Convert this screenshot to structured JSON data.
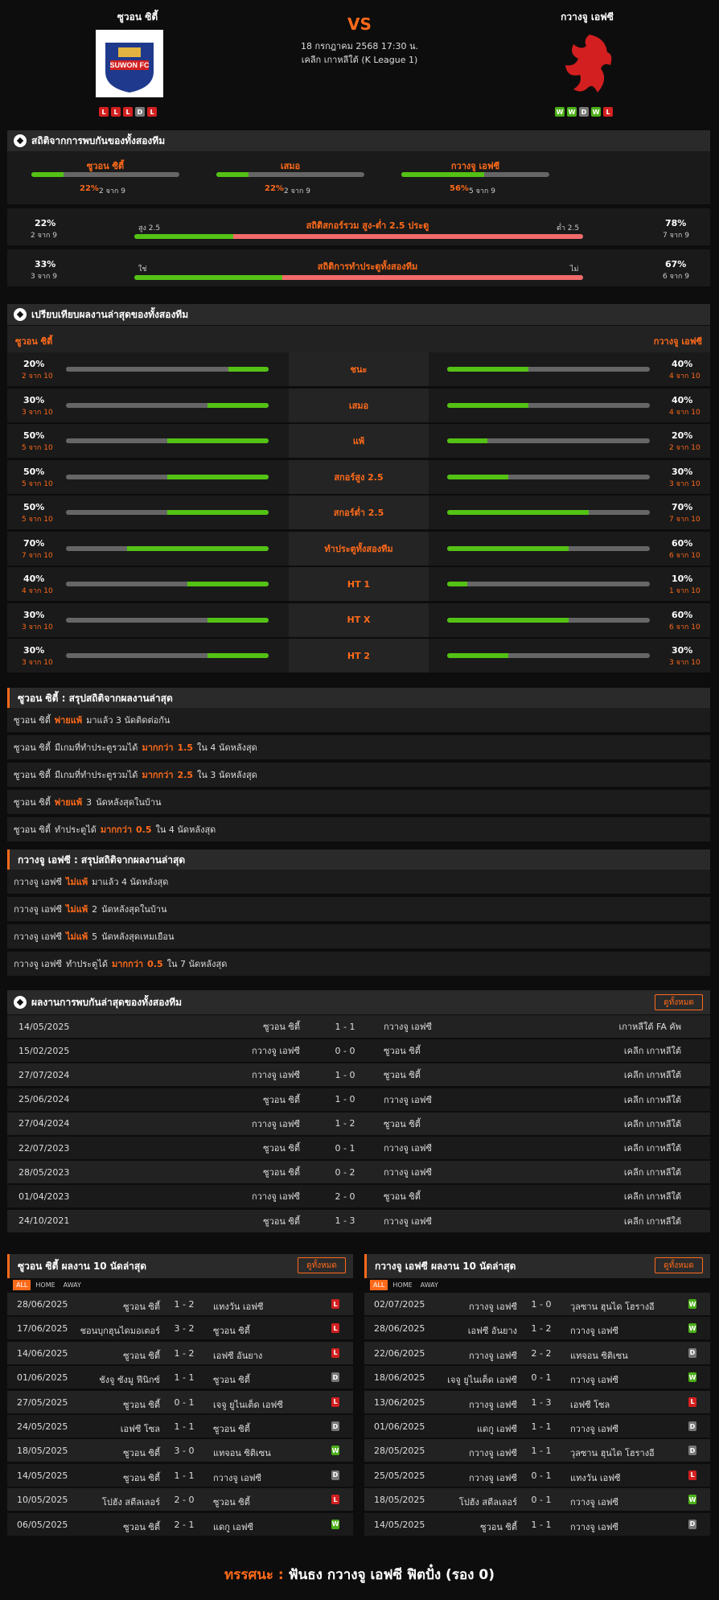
{
  "header": {
    "home": {
      "name": "ซูวอน ซิตี้",
      "form": [
        "L",
        "L",
        "L",
        "D",
        "L"
      ],
      "logo_text": "SUWON FC"
    },
    "away": {
      "name": "กวางจู เอฟซี",
      "form": [
        "W",
        "W",
        "D",
        "W",
        "L"
      ]
    },
    "vs": "VS",
    "datetime": "18 กรกฎาคม 2568 17:30 น.",
    "league": "เคลีก เกาหลีใต้ (K League 1)"
  },
  "h2h_stats": {
    "title": "สถิติจากการพบกันของทั้งสองทีม",
    "cols": [
      {
        "label": "ซูวอน ซิตี้",
        "pct": "22%",
        "count": "2 จาก 9",
        "value": 0.22
      },
      {
        "label": "เสมอ",
        "pct": "22%",
        "count": "2 จาก 9",
        "value": 0.22
      },
      {
        "label": "กวางจู เอฟซี",
        "pct": "56%",
        "count": "5 จาก 9",
        "value": 0.56
      }
    ],
    "ou": {
      "title": "สถิติสกอร์รวม สูง-ต่ำ 2.5 ประตู",
      "left_pct": "22%",
      "left_count": "2 จาก 9",
      "left_label": "สูง 2.5",
      "right_pct": "78%",
      "right_count": "7 จาก 9",
      "right_label": "ต่ำ 2.5",
      "value": 0.22
    },
    "btts": {
      "title": "สถิติการทำประตูทั้งสองทีม",
      "left_pct": "33%",
      "left_count": "3 จาก 9",
      "left_label": "ใช่",
      "right_pct": "67%",
      "right_count": "6 จาก 9",
      "right_label": "ไม่",
      "value": 0.33
    }
  },
  "form_compare": {
    "title": "เปรียบเทียบผลงานล่าสุดของทั้งสองทีม",
    "home": "ซูวอน ซิตี้",
    "away": "กวางจู เอฟซี",
    "rows": [
      {
        "label": "ชนะ",
        "hp": "20%",
        "hc": "2 จาก 10",
        "hv": 0.2,
        "ap": "40%",
        "ac": "4 จาก 10",
        "av": 0.4
      },
      {
        "label": "เสมอ",
        "hp": "30%",
        "hc": "3 จาก 10",
        "hv": 0.3,
        "ap": "40%",
        "ac": "4 จาก 10",
        "av": 0.4
      },
      {
        "label": "แพ้",
        "hp": "50%",
        "hc": "5 จาก 10",
        "hv": 0.5,
        "ap": "20%",
        "ac": "2 จาก 10",
        "av": 0.2
      },
      {
        "label": "สกอร์สูง 2.5",
        "hp": "50%",
        "hc": "5 จาก 10",
        "hv": 0.5,
        "ap": "30%",
        "ac": "3 จาก 10",
        "av": 0.3
      },
      {
        "label": "สกอร์ต่ำ 2.5",
        "hp": "50%",
        "hc": "5 จาก 10",
        "hv": 0.5,
        "ap": "70%",
        "ac": "7 จาก 10",
        "av": 0.7
      },
      {
        "label": "ทำประตูทั้งสองทีม",
        "hp": "70%",
        "hc": "7 จาก 10",
        "hv": 0.7,
        "ap": "60%",
        "ac": "6 จาก 10",
        "av": 0.6
      },
      {
        "label": "HT 1",
        "hp": "40%",
        "hc": "4 จาก 10",
        "hv": 0.4,
        "ap": "10%",
        "ac": "1 จาก 10",
        "av": 0.1
      },
      {
        "label": "HT X",
        "hp": "30%",
        "hc": "3 จาก 10",
        "hv": 0.3,
        "ap": "60%",
        "ac": "6 จาก 10",
        "av": 0.6
      },
      {
        "label": "HT 2",
        "hp": "30%",
        "hc": "3 จาก 10",
        "hv": 0.3,
        "ap": "30%",
        "ac": "3 จาก 10",
        "av": 0.3
      }
    ]
  },
  "home_summary": {
    "title": "ซูวอน ซิตี้ : สรุปสถิติจากผลงานล่าสุด",
    "rows": [
      [
        {
          "t": "ซูวอน ซิตี้"
        },
        {
          "t": "พ่ายแพ้",
          "o": 1
        },
        {
          "t": "มาแล้ว 3 นัดติดต่อกัน"
        }
      ],
      [
        {
          "t": "ซูวอน ซิตี้"
        },
        {
          "t": "มีเกมที่ทำประตูรวมได้"
        },
        {
          "t": "มากกว่า",
          "o": 1
        },
        {
          "t": "1.5",
          "o": 1
        },
        {
          "t": "ใน 4 นัดหลังสุด"
        }
      ],
      [
        {
          "t": "ซูวอน ซิตี้"
        },
        {
          "t": "มีเกมที่ทำประตูรวมได้"
        },
        {
          "t": "มากกว่า",
          "o": 1
        },
        {
          "t": "2.5",
          "o": 1
        },
        {
          "t": "ใน 3 นัดหลังสุด"
        }
      ],
      [
        {
          "t": "ซูวอน ซิตี้"
        },
        {
          "t": "พ่ายแพ้",
          "o": 1
        },
        {
          "t": "3"
        },
        {
          "t": "นัดหลังสุดในบ้าน"
        }
      ],
      [
        {
          "t": "ซูวอน ซิตี้"
        },
        {
          "t": "ทำประตูได้"
        },
        {
          "t": "มากกว่า",
          "o": 1
        },
        {
          "t": "0.5",
          "o": 1
        },
        {
          "t": "ใน 4 นัดหลังสุด"
        }
      ]
    ]
  },
  "away_summary": {
    "title": "กวางจู เอฟซี : สรุปสถิติจากผลงานล่าสุด",
    "rows": [
      [
        {
          "t": "กวางจู เอฟซี"
        },
        {
          "t": "ไม่แพ้",
          "o": 1
        },
        {
          "t": "มาแล้ว 4 นัดหลังสุด"
        }
      ],
      [
        {
          "t": "กวางจู เอฟซี"
        },
        {
          "t": "ไม่แพ้",
          "o": 1
        },
        {
          "t": "2"
        },
        {
          "t": "นัดหลังสุดในบ้าน"
        }
      ],
      [
        {
          "t": "กวางจู เอฟซี"
        },
        {
          "t": "ไม่แพ้",
          "o": 1
        },
        {
          "t": "5"
        },
        {
          "t": "นัดหลังสุดเหมเยือน"
        }
      ],
      [
        {
          "t": "กวางจู เอฟซี"
        },
        {
          "t": "ทำประตูได้"
        },
        {
          "t": "มากกว่า",
          "o": 1
        },
        {
          "t": "0.5",
          "o": 1
        },
        {
          "t": "ใน 7 นัดหลังสุด"
        }
      ]
    ]
  },
  "h2h_matches": {
    "title": "ผลงานการพบกันล่าสุดของทั้งสองทีม",
    "all_label": "ดูทั้งหมด",
    "rows": [
      [
        "14/05/2025",
        "ซูวอน ซิตี้",
        "1 - 1",
        "กวางจู เอฟซี",
        "เกาหลีใต้ FA คัพ"
      ],
      [
        "15/02/2025",
        "กวางจู เอฟซี",
        "0 - 0",
        "ซูวอน ซิตี้",
        "เคลีก เกาหลีใต้"
      ],
      [
        "27/07/2024",
        "กวางจู เอฟซี",
        "1 - 0",
        "ซูวอน ซิตี้",
        "เคลีก เกาหลีใต้"
      ],
      [
        "25/06/2024",
        "ซูวอน ซิตี้",
        "1 - 0",
        "กวางจู เอฟซี",
        "เคลีก เกาหลีใต้"
      ],
      [
        "27/04/2024",
        "กวางจู เอฟซี",
        "1 - 2",
        "ซูวอน ซิตี้",
        "เคลีก เกาหลีใต้"
      ],
      [
        "22/07/2023",
        "ซูวอน ซิตี้",
        "0 - 1",
        "กวางจู เอฟซี",
        "เคลีก เกาหลีใต้"
      ],
      [
        "28/05/2023",
        "ซูวอน ซิตี้",
        "0 - 2",
        "กวางจู เอฟซี",
        "เคลีก เกาหลีใต้"
      ],
      [
        "01/04/2023",
        "กวางจู เอฟซี",
        "2 - 0",
        "ซูวอน ซิตี้",
        "เคลีก เกาหลีใต้"
      ],
      [
        "24/10/2021",
        "ซูวอน ซิตี้",
        "1 - 3",
        "กวางจู เอฟซี",
        "เคลีก เกาหลีใต้"
      ]
    ]
  },
  "home_last10": {
    "title": "ซูวอน ซิตี้ ผลงาน 10 นัดล่าสุด",
    "all_label": "ดูทั้งหมด",
    "tabs": [
      "ALL",
      "HOME",
      "AWAY"
    ],
    "rows": [
      [
        "28/06/2025",
        "ซูวอน ซิตี้",
        "1 - 2",
        "แทงวัน เอฟซี",
        "L"
      ],
      [
        "17/06/2025",
        "ชอนบุกฮุนไดมอเตอร์",
        "3 - 2",
        "ซูวอน ซิตี้",
        "L"
      ],
      [
        "14/06/2025",
        "ซูวอน ซิตี้",
        "1 - 2",
        "เอฟซี อันยาง",
        "L"
      ],
      [
        "01/06/2025",
        "ชังจู ซังมู ฟีนิกซ์",
        "1 - 1",
        "ซูวอน ซิตี้",
        "D"
      ],
      [
        "27/05/2025",
        "ซูวอน ซิตี้",
        "0 - 1",
        "เจจู ยูไนเต็ด เอฟซี",
        "L"
      ],
      [
        "24/05/2025",
        "เอฟซี โซล",
        "1 - 1",
        "ซูวอน ซิตี้",
        "D"
      ],
      [
        "18/05/2025",
        "ซูวอน ซิตี้",
        "3 - 0",
        "แทจอน ซิติเซน",
        "W"
      ],
      [
        "14/05/2025",
        "ซูวอน ซิตี้",
        "1 - 1",
        "กวางจู เอฟซี",
        "D"
      ],
      [
        "10/05/2025",
        "โปฮัง สตีลเลอร์",
        "2 - 0",
        "ซูวอน ซิตี้",
        "L"
      ],
      [
        "06/05/2025",
        "ซูวอน ซิตี้",
        "2 - 1",
        "แดกู เอฟซี",
        "W"
      ]
    ]
  },
  "away_last10": {
    "title": "กวางจู เอฟซี ผลงาน 10 นัดล่าสุด",
    "all_label": "ดูทั้งหมด",
    "tabs": [
      "ALL",
      "HOME",
      "AWAY"
    ],
    "rows": [
      [
        "02/07/2025",
        "กวางจู เอฟซี",
        "1 - 0",
        "วุลซาน ฮุนได โฮรางอี",
        "W"
      ],
      [
        "28/06/2025",
        "เอฟซี อันยาง",
        "1 - 2",
        "กวางจู เอฟซี",
        "W"
      ],
      [
        "22/06/2025",
        "กวางจู เอฟซี",
        "2 - 2",
        "แทจอน ซิติเซน",
        "D"
      ],
      [
        "18/06/2025",
        "เจจู ยูไนเต็ด เอฟซี",
        "0 - 1",
        "กวางจู เอฟซี",
        "W"
      ],
      [
        "13/06/2025",
        "กวางจู เอฟซี",
        "1 - 3",
        "เอฟซี โซล",
        "L"
      ],
      [
        "01/06/2025",
        "แดกู เอฟซี",
        "1 - 1",
        "กวางจู เอฟซี",
        "D"
      ],
      [
        "28/05/2025",
        "กวางจู เอฟซี",
        "1 - 1",
        "วุลซาน ฮุนได โฮรางอี",
        "D"
      ],
      [
        "25/05/2025",
        "กวางจู เอฟซี",
        "0 - 1",
        "แทงวัน เอฟซี",
        "L"
      ],
      [
        "18/05/2025",
        "โปฮัง สตีลเลอร์",
        "0 - 1",
        "กวางจู เอฟซี",
        "W"
      ],
      [
        "14/05/2025",
        "ซูวอน ซิตี้",
        "1 - 1",
        "กวางจู เอฟซี",
        "D"
      ]
    ]
  },
  "prediction": {
    "label": "ทรรศนะ :",
    "text": "ฟันธง กวางจู เอฟซี ฟิตปั๋ง (รอง 0)"
  }
}
